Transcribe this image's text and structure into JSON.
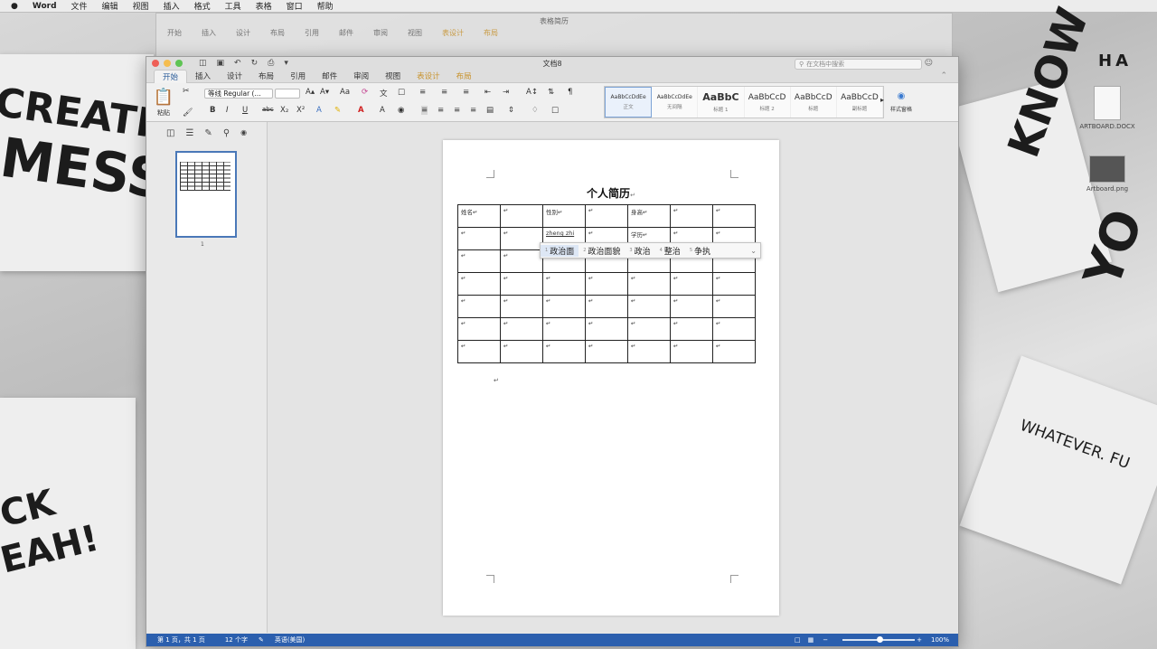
{
  "menubar": {
    "apple": "",
    "app": "Word",
    "items": [
      "文件",
      "编辑",
      "视图",
      "插入",
      "格式",
      "工具",
      "表格",
      "窗口",
      "帮助"
    ]
  },
  "desktop": {
    "poster_words": [
      "CREATIVE",
      "MESS",
      "WHATEVER. FU",
      "CK",
      "EAH!",
      "KNOW",
      "YO",
      "HA"
    ],
    "icons": [
      {
        "label": "ARTBOARD.DOCX",
        "kind": "doc-icon"
      },
      {
        "label": "Artboard.png",
        "kind": "image-icon"
      }
    ]
  },
  "bg_window": {
    "title": "表格简历",
    "search": "在文档中搜索",
    "tabs": [
      "开始",
      "插入",
      "设计",
      "布局",
      "引用",
      "邮件",
      "审阅",
      "视图",
      "表设计",
      "布局"
    ]
  },
  "window": {
    "title": "文档8",
    "search_placeholder": "在文档中搜索",
    "tabs": [
      {
        "label": "开始",
        "active": true,
        "ctx": false
      },
      {
        "label": "插入",
        "active": false,
        "ctx": false
      },
      {
        "label": "设计",
        "active": false,
        "ctx": false
      },
      {
        "label": "布局",
        "active": false,
        "ctx": false
      },
      {
        "label": "引用",
        "active": false,
        "ctx": false
      },
      {
        "label": "邮件",
        "active": false,
        "ctx": false
      },
      {
        "label": "审阅",
        "active": false,
        "ctx": false
      },
      {
        "label": "视图",
        "active": false,
        "ctx": false
      },
      {
        "label": "表设计",
        "active": false,
        "ctx": true
      },
      {
        "label": "布局",
        "active": false,
        "ctx": true
      }
    ],
    "ribbon": {
      "paste_label": "粘贴",
      "font_name": "等线 Regular (...",
      "font_size": "",
      "styles": [
        {
          "preview": "AaBbCcDdEe",
          "name": "正文",
          "selected": true
        },
        {
          "preview": "AaBbCcDdEe",
          "name": "无间隔",
          "selected": false
        },
        {
          "preview": "AaBbC",
          "name": "标题 1",
          "selected": false
        },
        {
          "preview": "AaBbCcD",
          "name": "标题 2",
          "selected": false
        },
        {
          "preview": "AaBbCcD",
          "name": "标题",
          "selected": false
        },
        {
          "preview": "AaBbCcD",
          "name": "副标题",
          "selected": false
        }
      ],
      "styles_pane_label": "样式窗格"
    },
    "sidepane": {
      "page_number": "1"
    },
    "document": {
      "heading": "个人简历",
      "para_mark": "↵",
      "rows": [
        [
          "姓名↵",
          "↵",
          "性别↵",
          "↵",
          "身高↵",
          "↵",
          "↵"
        ],
        [
          "↵",
          "↵",
          "zheng zhi",
          "↵",
          "学历↵",
          "↵",
          "↵"
        ],
        [
          "↵",
          "↵",
          "↵",
          "↵",
          "↵",
          "↵",
          "↵"
        ],
        [
          "↵",
          "↵",
          "↵",
          "↵",
          "↵",
          "↵",
          "↵"
        ],
        [
          "↵",
          "↵",
          "↵",
          "↵",
          "↵",
          "↵",
          "↵"
        ],
        [
          "↵",
          "↵",
          "↵",
          "↵",
          "↵",
          "↵",
          "↵"
        ],
        [
          "↵",
          "↵",
          "↵",
          "↵",
          "↵",
          "↵",
          "↵"
        ]
      ],
      "ime_candidates": [
        {
          "num": "1",
          "text": "政治面"
        },
        {
          "num": "2",
          "text": "政治面貌"
        },
        {
          "num": "3",
          "text": "政治"
        },
        {
          "num": "4",
          "text": "整治"
        },
        {
          "num": "5",
          "text": "争执"
        }
      ],
      "ime_more": "⌄"
    },
    "status": {
      "page": "第 1 页，共 1 页",
      "words": "12 个字",
      "language": "英语(美国)",
      "zoom": "100%",
      "zoom_level_fraction": 0.5
    }
  }
}
